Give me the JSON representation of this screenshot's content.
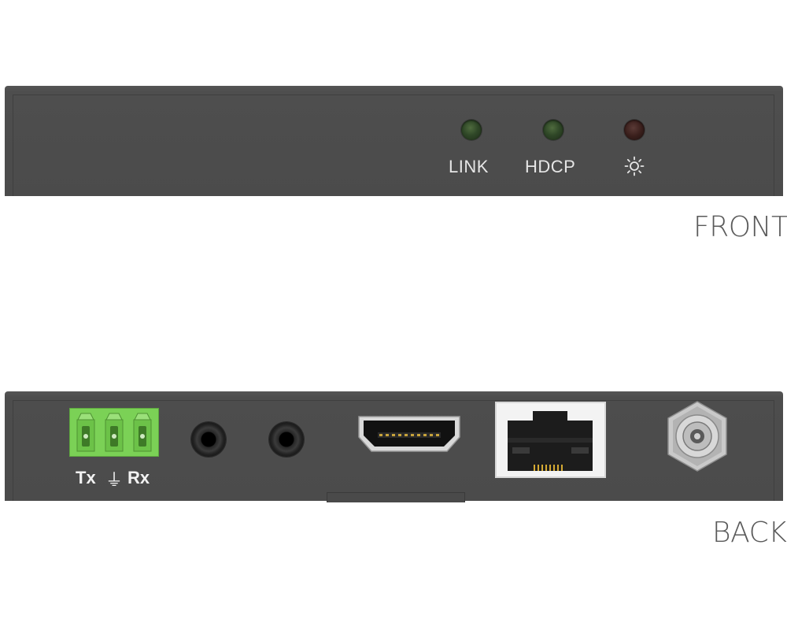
{
  "front": {
    "section_label": "FRONT",
    "leds": [
      {
        "label": "LINK",
        "color": "#2f4727"
      },
      {
        "label": "HDCP",
        "color": "#2f4727"
      },
      {
        "label": "",
        "icon": "sun-icon",
        "color": "#3a1f1c"
      }
    ]
  },
  "back": {
    "section_label": "BACK",
    "terminal_block": {
      "label_tx": "Tx",
      "label_ground": "⏚",
      "label_rx": "Rx",
      "color": "#7bd156"
    },
    "ports": [
      {
        "name": "audio-jack-1"
      },
      {
        "name": "audio-jack-2"
      },
      {
        "name": "hdmi-port"
      },
      {
        "name": "rj45-port"
      },
      {
        "name": "dc-power-jack"
      }
    ]
  },
  "colors": {
    "chassis": "#4b4b4b",
    "label_text": "#5a5a5a",
    "panel_text": "#e6e6e6"
  }
}
